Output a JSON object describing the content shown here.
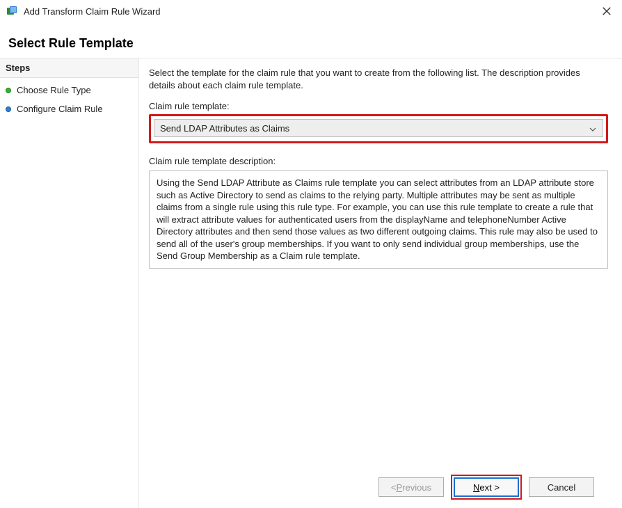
{
  "window": {
    "title": "Add Transform Claim Rule Wizard"
  },
  "header": {
    "title": "Select Rule Template"
  },
  "steps": {
    "heading": "Steps",
    "items": [
      {
        "label": "Choose Rule Type",
        "state": "done"
      },
      {
        "label": "Configure Claim Rule",
        "state": "pending"
      }
    ]
  },
  "content": {
    "intro": "Select the template for the claim rule that you want to create from the following list. The description provides details about each claim rule template.",
    "template_label": "Claim rule template:",
    "template_selected": "Send LDAP Attributes as Claims",
    "desc_label": "Claim rule template description:",
    "desc_text": "Using the Send LDAP Attribute as Claims rule template you can select attributes from an LDAP attribute store such as Active Directory to send as claims to the relying party. Multiple attributes may be sent as multiple claims from a single rule using this rule type. For example, you can use this rule template to create a rule that will extract attribute values for authenticated users from the displayName and telephoneNumber Active Directory attributes and then send those values as two different outgoing claims. This rule may also be used to send all of the user's group memberships. If you want to only send individual group memberships, use the Send Group Membership as a Claim rule template."
  },
  "buttons": {
    "previous_prefix": "< ",
    "previous_u": "P",
    "previous_rest": "revious",
    "next_u": "N",
    "next_rest": "ext >",
    "cancel": "Cancel"
  }
}
